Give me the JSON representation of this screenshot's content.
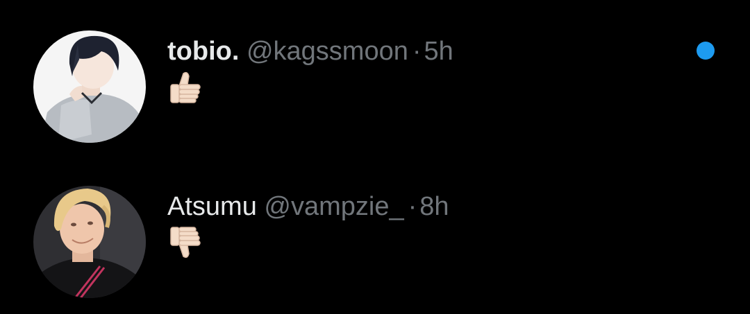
{
  "colors": {
    "background": "#000000",
    "primary_text": "#e7e9ea",
    "secondary_text": "#71767b",
    "unread_accent": "#1d9bf0",
    "emoji_skin": "#f4dcc8"
  },
  "notifications": [
    {
      "display_name": "tobio.",
      "handle": "@kagssmoon",
      "separator": "·",
      "time": "5h",
      "content_emoji": "thumbs-up",
      "avatar_icon": "anime-avatar",
      "unread": true
    },
    {
      "display_name": "Atsumu",
      "handle": "@vampzie_",
      "separator": "·",
      "time": "8h",
      "content_emoji": "thumbs-down",
      "avatar_icon": "photo-avatar",
      "unread": false
    }
  ]
}
